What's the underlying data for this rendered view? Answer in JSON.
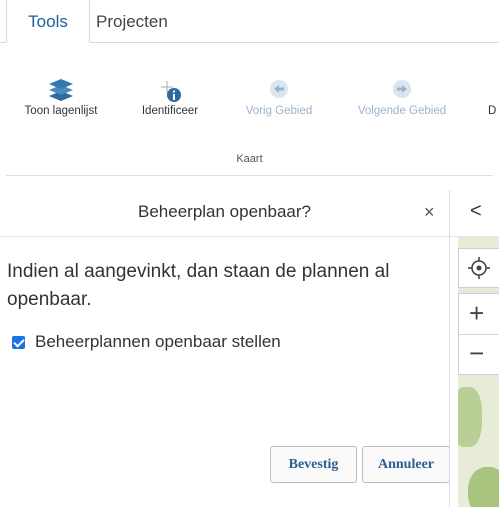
{
  "tabs": [
    {
      "label": "Tools",
      "active": true
    },
    {
      "label": "Projecten",
      "active": false
    }
  ],
  "ribbon": {
    "items": [
      {
        "label": "Toon lagenlijst",
        "icon": "layers-icon",
        "enabled": true
      },
      {
        "label": "Identificeer",
        "icon": "identify-icon",
        "enabled": true
      },
      {
        "label": "Vorig Gebied",
        "icon": "arrow-left-icon",
        "enabled": false
      },
      {
        "label": "Volgende Gebied",
        "icon": "arrow-right-icon",
        "enabled": false
      },
      {
        "label": "D",
        "icon": "",
        "enabled": true
      }
    ],
    "group_label": "Kaart"
  },
  "dialog": {
    "title": "Beheerplan openbaar?",
    "close_symbol": "×",
    "message": "Indien al aangevinkt, dan staan de plannen al openbaar.",
    "checkbox_label": "Beheerplannen openbaar stellen",
    "checkbox_checked": true,
    "confirm_label": "Bevestig",
    "cancel_label": "Annuleer"
  },
  "map": {
    "collapse_symbol": "<",
    "zoom_in_symbol": "+",
    "zoom_out_symbol": "−"
  },
  "colors": {
    "accent": "#1f5f99",
    "checkbox": "#1a73e8",
    "disabled": "#9ab3cc"
  }
}
